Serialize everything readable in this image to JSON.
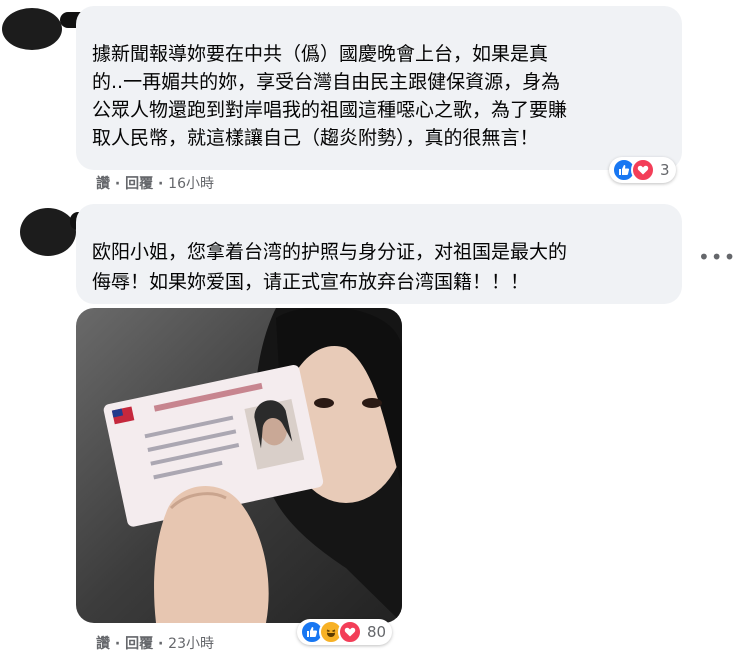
{
  "comments": [
    {
      "lines": [
        "據新聞報導妳要在中共（僞）國慶晚會上台，如果是真",
        "的..一再媚共的妳，享受台灣自由民主跟健保資源，身為",
        "公眾人物還跑到對岸唱我的祖國這種噁心之歌，為了要賺",
        "取人民幣，就這樣讓自己（趨炎附勢），真的很無言！"
      ],
      "like_label": "讚",
      "separator": "·",
      "reply_label": "回覆",
      "time": "16小時",
      "reactions": [
        "like-icon",
        "love-icon"
      ],
      "reaction_count": "3"
    },
    {
      "lines": [
        "欧阳小姐，您拿着台湾的护照与身分证，对祖国是最大的",
        "侮辱！如果妳爱国，请正式宣布放弃台湾国籍！！！"
      ],
      "more_label": "•••",
      "like_label": "讚",
      "separator": "·",
      "reply_label": "回覆",
      "time": "23小時",
      "reactions": [
        "like-icon",
        "haha-icon",
        "love-icon"
      ],
      "reaction_count": "80"
    }
  ],
  "colors": {
    "bubble": "#f0f2f5",
    "meta": "#65676b",
    "like": "#1877f2",
    "love": "#f33e58",
    "haha": "#f7b125"
  }
}
